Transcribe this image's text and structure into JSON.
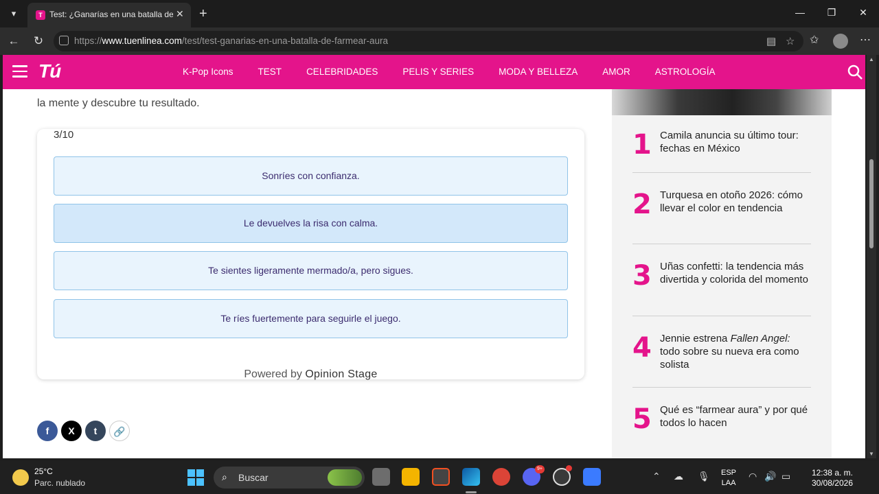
{
  "browser": {
    "tab_title": "Test: ¿Ganarías en una batalla de farmear aura?",
    "url_prefix": "https://",
    "url_domain": "www.tuenlinea.com",
    "url_path": "/test/test-ganarias-en-una-batalla-de-farmear-aura"
  },
  "site": {
    "logo": "Tú",
    "nav": [
      "K-Pop Icons",
      "TEST",
      "CELEBRIDADES",
      "PELIS Y SERIES",
      "MODA Y BELLEZA",
      "AMOR",
      "ASTROLOGÍA"
    ],
    "accent_color": "#e4148b"
  },
  "article": {
    "intro": "la mente y descubre tu resultado."
  },
  "quiz": {
    "progress": "3/10",
    "options": [
      "Sonríes con confianza.",
      "Le devuelves la risa con calma.",
      "Te sientes ligeramente mermado/a, pero sigues.",
      "Te ríes fuertemente para seguirle el juego."
    ],
    "powered_by_prefix": "Powered by ",
    "powered_by_brand": "Opinion Stage"
  },
  "share": {
    "facebook": "f",
    "x": "X",
    "tumblr": "t"
  },
  "trending": [
    {
      "num": "1",
      "text": "Camila anuncia su último tour: fechas en México"
    },
    {
      "num": "2",
      "text": "Turquesa en otoño 2026: cómo llevar el color en tendencia"
    },
    {
      "num": "3",
      "text": "Uñas confetti: la tendencia más divertida y colorida del momento"
    },
    {
      "num": "4",
      "text_prefix": "Jennie estrena ",
      "text_italic": "Fallen Angel:",
      "text_suffix": " todo sobre su nueva era como solista"
    },
    {
      "num": "5",
      "text": "Qué es “farmear aura” y por qué todos lo hacen"
    }
  ],
  "taskbar": {
    "temperature": "25°C",
    "weather": "Parc. nublado",
    "search_placeholder": "Buscar",
    "lang_line1": "ESP",
    "lang_line2": "LAA",
    "time": "12:38 a. m.",
    "date": "30/08/2026",
    "discord_badge": "9+"
  }
}
